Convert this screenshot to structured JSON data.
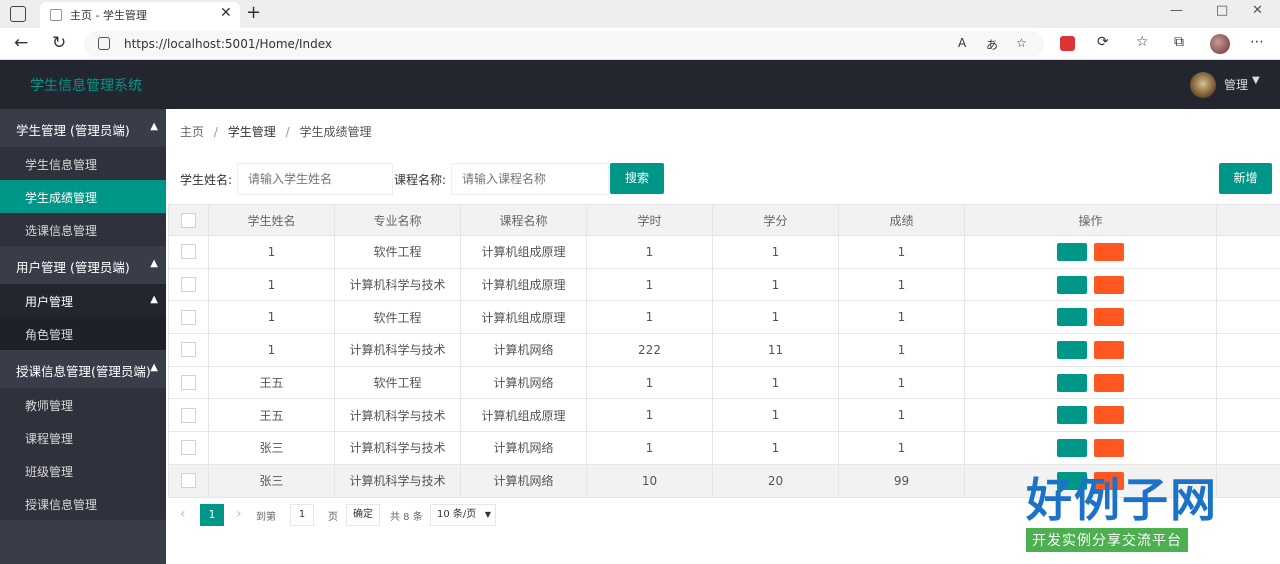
{
  "browser": {
    "tab_title": "主页 - 学生管理",
    "url": "https://localhost:5001/Home/Index",
    "read_aloud": "A",
    "translate": "あ"
  },
  "header": {
    "app_title": "学生信息管理系统",
    "user_name": "管理"
  },
  "sidebar": {
    "group1": {
      "label": "学生管理 (管理员端)"
    },
    "items1": [
      "学生信息管理",
      "学生成绩管理",
      "选课信息管理"
    ],
    "group2": {
      "label": "用户管理 (管理员端)"
    },
    "sub_head": "用户管理",
    "items2": [
      "角色管理"
    ],
    "group3": {
      "label": "授课信息管理(管理员端)"
    },
    "items3": [
      "教师管理",
      "课程管理",
      "班级管理",
      "授课信息管理"
    ]
  },
  "breadcrumb": [
    "主页",
    "学生管理",
    "/",
    "学生成绩管理"
  ],
  "search": {
    "student_label": "学生姓名:",
    "student_placeholder": "请输入学生姓名",
    "course_label": "课程名称:",
    "course_placeholder": "请输入课程名称",
    "search_btn": "搜索",
    "add_btn": "新增"
  },
  "table": {
    "headers": [
      "学生姓名",
      "专业名称",
      "课程名称",
      "学时",
      "学分",
      "成绩",
      "操作"
    ],
    "rows": [
      [
        "1",
        "软件工程",
        "计算机组成原理",
        "1",
        "1",
        "1"
      ],
      [
        "1",
        "计算机科学与技术",
        "计算机组成原理",
        "1",
        "1",
        "1"
      ],
      [
        "1",
        "软件工程",
        "计算机组成原理",
        "1",
        "1",
        "1"
      ],
      [
        "1",
        "计算机科学与技术",
        "计算机网络",
        "222",
        "11",
        "1"
      ],
      [
        "王五",
        "软件工程",
        "计算机网络",
        "1",
        "1",
        "1"
      ],
      [
        "王五",
        "计算机科学与技术",
        "计算机组成原理",
        "1",
        "1",
        "1"
      ],
      [
        "张三",
        "计算机科学与技术",
        "计算机网络",
        "1",
        "1",
        "1"
      ],
      [
        "张三",
        "计算机科学与技术",
        "计算机网络",
        "10",
        "20",
        "99"
      ]
    ]
  },
  "pager": {
    "current": "1",
    "goto_label": "到第",
    "goto_value": "1",
    "page_unit": "页",
    "confirm": "确定",
    "total": "共 8 条",
    "page_size": "10 条/页"
  },
  "watermark": {
    "big": "好例子网",
    "small": "开发实例分享交流平台"
  }
}
